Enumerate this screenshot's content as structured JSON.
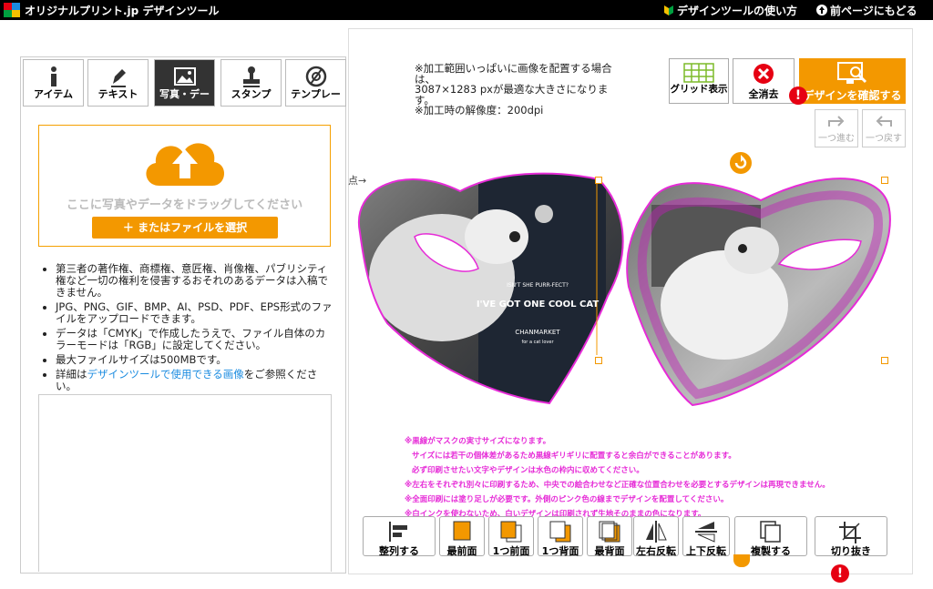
{
  "header": {
    "brand": "オリジナルプリント.jp デザインツール",
    "help_link": "デザインツールの使い方",
    "back_link": "前ページにもどる"
  },
  "tabs": [
    {
      "label": "アイテム",
      "icon": "info-icon"
    },
    {
      "label": "テキスト",
      "icon": "pen-icon"
    },
    {
      "label": "写真・デー",
      "icon": "image-icon"
    },
    {
      "label": "スタンプ",
      "icon": "stamp-icon"
    },
    {
      "label": "テンプレー",
      "icon": "template-icon"
    }
  ],
  "upload": {
    "drop_text": "ここに写真やデータをドラッグしてください",
    "select_button": "＋ またはファイルを選択"
  },
  "notes": {
    "n1": "第三者の著作権、商標権、意匠権、肖像権、パブリシティ権など一切の権利を侵害するおそれのあるデータは入稿できません。",
    "n2": "JPG、PNG、GIF、BMP、AI、PSD、PDF、EPS形式のファイルをアップロードできます。",
    "n3": "データは「CMYK」で作成したうえで、ファイル自体のカラーモードは「RGB」に設定してください。",
    "n4": "最大ファイルサイズは500MBです。",
    "n5_pre": "詳細は",
    "n5_link": "デザインツールで使用できる画像",
    "n5_post": "をご参照ください。"
  },
  "print_info": {
    "line1": "※加工範囲いっぱいに画像を配置する場合は、",
    "line2": "3087×1283 pxが最適な大きさになります。",
    "line3": "※加工時の解像度：200dpi"
  },
  "toolbar": {
    "grid_label": "グリッド表示",
    "clear_label": "全消去",
    "confirm_label": "デザインを確認する",
    "redo_label": "一つ進む",
    "undo_label": "一つ戻す"
  },
  "canvas": {
    "start_hint": "点→",
    "design_text1": "ISN'T SHE PURR-FECT?",
    "design_text2": "I'VE GOT ONE COOL CAT",
    "design_text3": "CHANMARKET",
    "design_text4": "for a cat lover"
  },
  "warnings": [
    "※黒線がマスクの実寸サイズになります。",
    "サイズには若干の個体差があるため黒線ギリギリに配置すると余白ができることがあります。",
    "必ず印刷させたい文字やデザインは水色の枠内に収めてください。",
    "※左右をそれぞれ別々に印刷するため、中央での絵合わせなど正確な位置合わせを必要とするデザインは再現できません。",
    "※全面印刷には塗り足しが必要です。外側のピンク色の線までデザインを配置してください。",
    "※白インクを使わないため、白いデザインは印刷されず生地そのままの色になります。"
  ],
  "bottom_tools": [
    {
      "label": "整列する",
      "icon": "align-icon"
    },
    {
      "label": "最前面",
      "icon": "bring-front-icon"
    },
    {
      "label": "1つ前面",
      "icon": "bring-forward-icon"
    },
    {
      "label": "1つ背面",
      "icon": "send-backward-icon"
    },
    {
      "label": "最背面",
      "icon": "send-back-icon"
    },
    {
      "label": "左右反転",
      "icon": "flip-h-icon"
    },
    {
      "label": "上下反転",
      "icon": "flip-v-icon"
    },
    {
      "label": "複製する",
      "icon": "duplicate-icon"
    },
    {
      "label": "切り抜き",
      "icon": "crop-icon"
    }
  ],
  "colors": {
    "accent": "#f39800",
    "magenta": "#e62bd7",
    "alert": "#e60012",
    "link": "#1a8be0"
  }
}
